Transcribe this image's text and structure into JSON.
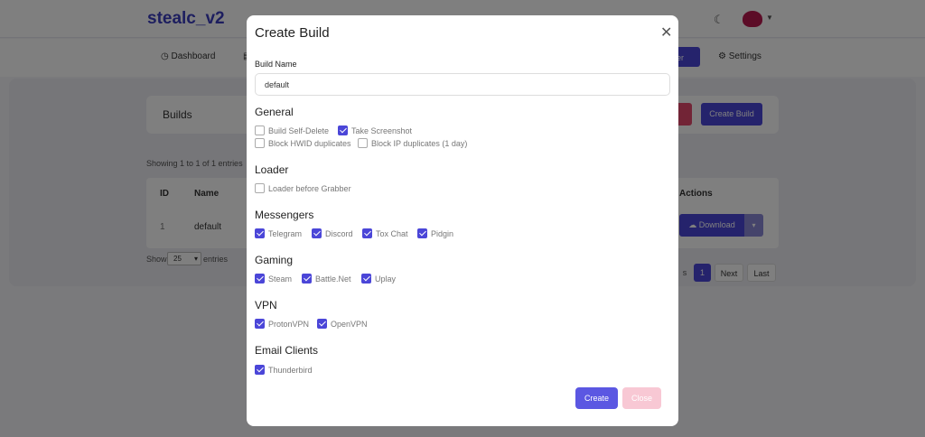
{
  "app": {
    "brand": "stealc_v2"
  },
  "nav": {
    "dashboard": "Dashboard",
    "builder_fragment": "der",
    "settings": "Settings"
  },
  "builds": {
    "title": "Builds",
    "create_build_label": "Create Build",
    "showing_text": "Showing 1 to 1 of 1 entries",
    "columns": [
      "ID",
      "Name",
      "Actions"
    ],
    "rows": [
      {
        "id": "1",
        "name": "default"
      }
    ],
    "download_label": "Download",
    "show_label": "Show",
    "show_value": "25",
    "entries_label": "entries",
    "pagination": {
      "prev_fragment": "s",
      "current": "1",
      "next": "Next",
      "last": "Last"
    }
  },
  "modal": {
    "title": "Create Build",
    "build_name_label": "Build Name",
    "build_name_value": "default",
    "sections": {
      "general": "General",
      "loader": "Loader",
      "messengers": "Messengers",
      "gaming": "Gaming",
      "vpn": "VPN",
      "email": "Email Clients"
    },
    "options": {
      "self_delete": {
        "label": "Build Self-Delete",
        "checked": false
      },
      "screenshot": {
        "label": "Take Screenshot",
        "checked": true
      },
      "hwid": {
        "label": "Block HWID duplicates",
        "checked": false
      },
      "ip": {
        "label": "Block IP duplicates (1 day)",
        "checked": false
      },
      "loader_before": {
        "label": "Loader before Grabber",
        "checked": false
      },
      "telegram": {
        "label": "Telegram",
        "checked": true
      },
      "discord": {
        "label": "Discord",
        "checked": true
      },
      "tox": {
        "label": "Tox Chat",
        "checked": true
      },
      "pidgin": {
        "label": "Pidgin",
        "checked": true
      },
      "steam": {
        "label": "Steam",
        "checked": true
      },
      "battlenet": {
        "label": "Battle.Net",
        "checked": true
      },
      "uplay": {
        "label": "Uplay",
        "checked": true
      },
      "protonvpn": {
        "label": "ProtonVPN",
        "checked": true
      },
      "openvpn": {
        "label": "OpenVPN",
        "checked": true
      },
      "thunderbird": {
        "label": "Thunderbird",
        "checked": true
      }
    },
    "create_label": "Create",
    "close_label": "Close"
  },
  "colors": {
    "accent": "#4b46d8",
    "danger_light": "#f8c8d4"
  }
}
